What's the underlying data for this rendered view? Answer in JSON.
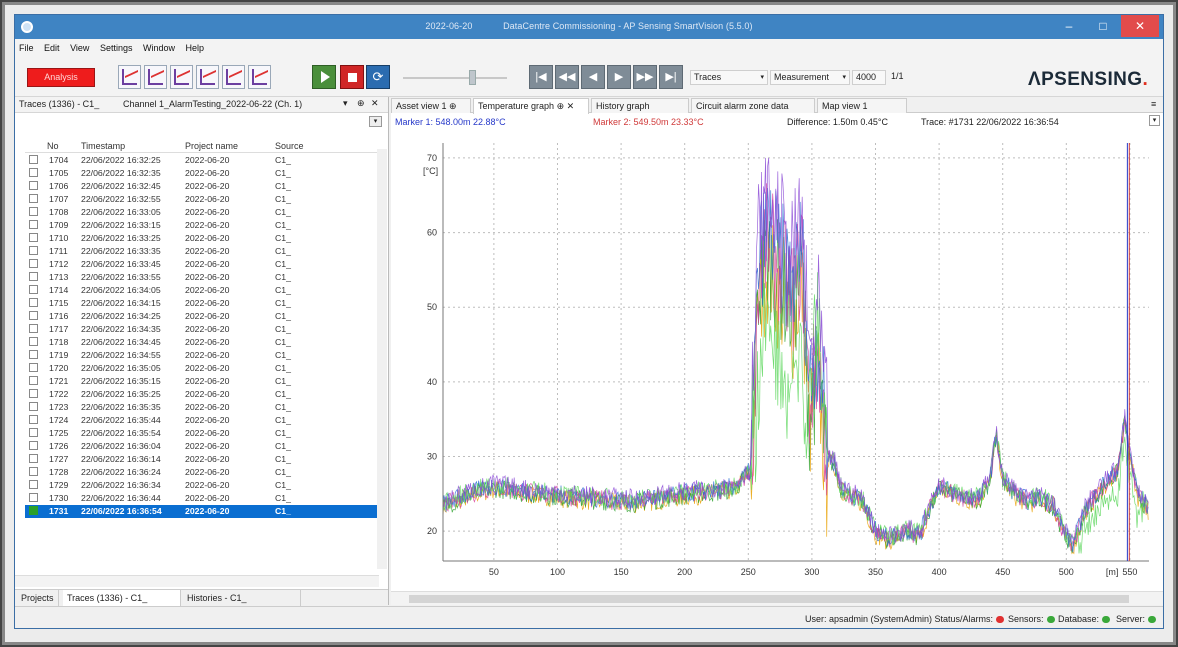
{
  "window": {
    "title_date": "2022-06-20",
    "title_text": "DataCentre Commissioning - AP Sensing SmartVision (5.5.0)",
    "minimize": "–",
    "maximize": "□",
    "close": "✕"
  },
  "menu": [
    "File",
    "Edit",
    "View",
    "Settings",
    "Window",
    "Help"
  ],
  "toolbar": {
    "analysis_label": "Analysis",
    "refresh_icon": "⟳",
    "nav_labels": [
      "|◀",
      "◀◀",
      "◀",
      "▶",
      "▶▶",
      "▶|"
    ],
    "combo_traces": "Traces",
    "combo_measurement": "Measurement",
    "combo_value": "4000",
    "page_indicator": "1/1",
    "dropdown_arrow": "▾"
  },
  "brand": {
    "logo_main": "ΛPSENSING",
    "logo_dot": "."
  },
  "left_pane": {
    "header_traces": "Traces (1336) - C1_",
    "header_channel": "Channel 1_AlarmTesting_2022-06-22 (Ch. 1)",
    "pin_icon": "▾",
    "dock_icon": "⊕",
    "close_icon": "✕",
    "filter_icon": "▾",
    "columns": [
      "No",
      "Timestamp",
      "Project name",
      "Source"
    ],
    "rows": [
      {
        "no": "1704",
        "ts": "22/06/2022 16:32:25",
        "project": "2022-06-20",
        "source": "C1_"
      },
      {
        "no": "1705",
        "ts": "22/06/2022 16:32:35",
        "project": "2022-06-20",
        "source": "C1_"
      },
      {
        "no": "1706",
        "ts": "22/06/2022 16:32:45",
        "project": "2022-06-20",
        "source": "C1_"
      },
      {
        "no": "1707",
        "ts": "22/06/2022 16:32:55",
        "project": "2022-06-20",
        "source": "C1_"
      },
      {
        "no": "1708",
        "ts": "22/06/2022 16:33:05",
        "project": "2022-06-20",
        "source": "C1_"
      },
      {
        "no": "1709",
        "ts": "22/06/2022 16:33:15",
        "project": "2022-06-20",
        "source": "C1_"
      },
      {
        "no": "1710",
        "ts": "22/06/2022 16:33:25",
        "project": "2022-06-20",
        "source": "C1_"
      },
      {
        "no": "1711",
        "ts": "22/06/2022 16:33:35",
        "project": "2022-06-20",
        "source": "C1_"
      },
      {
        "no": "1712",
        "ts": "22/06/2022 16:33:45",
        "project": "2022-06-20",
        "source": "C1_"
      },
      {
        "no": "1713",
        "ts": "22/06/2022 16:33:55",
        "project": "2022-06-20",
        "source": "C1_"
      },
      {
        "no": "1714",
        "ts": "22/06/2022 16:34:05",
        "project": "2022-06-20",
        "source": "C1_"
      },
      {
        "no": "1715",
        "ts": "22/06/2022 16:34:15",
        "project": "2022-06-20",
        "source": "C1_"
      },
      {
        "no": "1716",
        "ts": "22/06/2022 16:34:25",
        "project": "2022-06-20",
        "source": "C1_"
      },
      {
        "no": "1717",
        "ts": "22/06/2022 16:34:35",
        "project": "2022-06-20",
        "source": "C1_"
      },
      {
        "no": "1718",
        "ts": "22/06/2022 16:34:45",
        "project": "2022-06-20",
        "source": "C1_"
      },
      {
        "no": "1719",
        "ts": "22/06/2022 16:34:55",
        "project": "2022-06-20",
        "source": "C1_"
      },
      {
        "no": "1720",
        "ts": "22/06/2022 16:35:05",
        "project": "2022-06-20",
        "source": "C1_"
      },
      {
        "no": "1721",
        "ts": "22/06/2022 16:35:15",
        "project": "2022-06-20",
        "source": "C1_"
      },
      {
        "no": "1722",
        "ts": "22/06/2022 16:35:25",
        "project": "2022-06-20",
        "source": "C1_"
      },
      {
        "no": "1723",
        "ts": "22/06/2022 16:35:35",
        "project": "2022-06-20",
        "source": "C1_"
      },
      {
        "no": "1724",
        "ts": "22/06/2022 16:35:44",
        "project": "2022-06-20",
        "source": "C1_"
      },
      {
        "no": "1725",
        "ts": "22/06/2022 16:35:54",
        "project": "2022-06-20",
        "source": "C1_"
      },
      {
        "no": "1726",
        "ts": "22/06/2022 16:36:04",
        "project": "2022-06-20",
        "source": "C1_"
      },
      {
        "no": "1727",
        "ts": "22/06/2022 16:36:14",
        "project": "2022-06-20",
        "source": "C1_"
      },
      {
        "no": "1728",
        "ts": "22/06/2022 16:36:24",
        "project": "2022-06-20",
        "source": "C1_"
      },
      {
        "no": "1729",
        "ts": "22/06/2022 16:36:34",
        "project": "2022-06-20",
        "source": "C1_"
      },
      {
        "no": "1730",
        "ts": "22/06/2022 16:36:44",
        "project": "2022-06-20",
        "source": "C1_"
      },
      {
        "no": "1731",
        "ts": "22/06/2022 16:36:54",
        "project": "2022-06-20",
        "source": "C1_",
        "selected": true
      }
    ],
    "bottom_tabs": [
      "Projects",
      "Traces (1336) - C1_",
      "Histories - C1_"
    ]
  },
  "right_pane": {
    "tabs": [
      "Asset view 1",
      "Temperature graph",
      "History graph",
      "Circuit alarm zone data",
      "Map view 1"
    ],
    "tab_pin": "⊕",
    "tab_close": "✕",
    "marker1": "Marker 1: 548.00m 22.88°C",
    "marker2": "Marker 2: 549.50m 23.33°C",
    "difference": "Difference: 1.50m 0.45°C",
    "trace": "Trace: #1731 22/06/2022 16:36:54",
    "overflow_icon": "≡"
  },
  "chart_data": {
    "type": "line",
    "ylabel": "[°C]",
    "xlabel": "[m]",
    "xlim": [
      10,
      565
    ],
    "ylim": [
      16,
      72
    ],
    "yticks": [
      20,
      30,
      40,
      50,
      60,
      70
    ],
    "xticks": [
      50,
      100,
      150,
      200,
      250,
      300,
      350,
      400,
      450,
      500,
      550
    ],
    "grid": true,
    "marker_positions_m": [
      548.0,
      549.5
    ],
    "marker_colors": [
      "#2638c9",
      "#d03a3a"
    ],
    "series_colors": [
      "#e8a000",
      "#2aa02a",
      "#d63c9a",
      "#2a6fd1",
      "#59d659",
      "#8b4ad6"
    ],
    "trace_profile": {
      "x": [
        10,
        30,
        50,
        80,
        120,
        160,
        200,
        230,
        240,
        248,
        252,
        258,
        265,
        275,
        285,
        292,
        298,
        305,
        312,
        318,
        322,
        330,
        340,
        350,
        360,
        375,
        385,
        390,
        400,
        420,
        432,
        440,
        445,
        450,
        460,
        470,
        480,
        490,
        498,
        505,
        515,
        528,
        540,
        546,
        549,
        556,
        565
      ],
      "y": [
        23.5,
        25.0,
        26.0,
        25.2,
        24.5,
        24.0,
        25.0,
        25.5,
        26.0,
        27.5,
        28.0,
        55.0,
        60.0,
        56.0,
        52.0,
        58.0,
        38.0,
        45.0,
        30.0,
        29.0,
        26.0,
        25.0,
        24.0,
        20.0,
        19.0,
        20.0,
        19.5,
        22.0,
        26.0,
        24.5,
        24.5,
        27.0,
        33.0,
        27.0,
        25.0,
        24.0,
        24.5,
        23.5,
        20.0,
        18.0,
        23.0,
        26.0,
        28.0,
        35.0,
        31.0,
        25.0,
        23.0
      ]
    }
  },
  "status": {
    "user": "User: apsadmin (SystemAdmin) Status/Alarms:",
    "sensors": "Sensors:",
    "database": "Database:",
    "server": "Server:",
    "alarm_color": "#e03030",
    "ok_color": "#3aa83a"
  }
}
